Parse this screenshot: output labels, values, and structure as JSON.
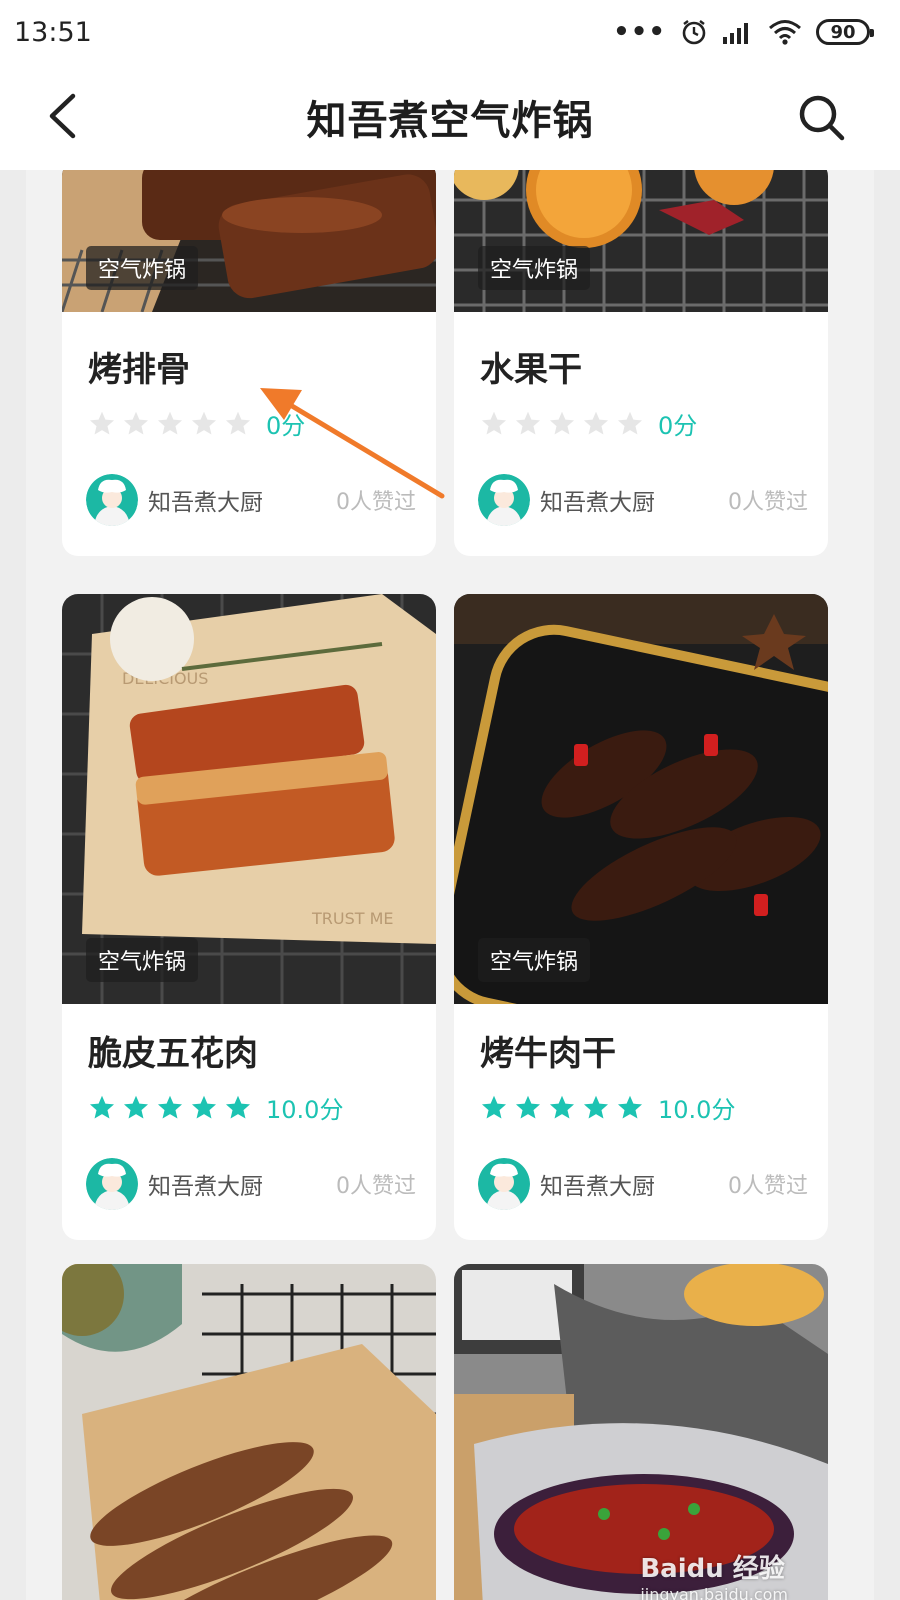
{
  "status_bar": {
    "time": "13:51",
    "battery": "90",
    "more_dots": "•••"
  },
  "header": {
    "title": "知吾煮空气炸锅"
  },
  "colors": {
    "accent": "#1cc3b2",
    "star_empty": "#e6e6e6",
    "tag_bg": "#2a2a2a"
  },
  "recipes": [
    {
      "title": "烤排骨",
      "tag": "空气炸锅",
      "score": "0分",
      "rating": 0,
      "author": "知吾煮大厨",
      "likes": "0人赞过"
    },
    {
      "title": "水果干",
      "tag": "空气炸锅",
      "score": "0分",
      "rating": 0,
      "author": "知吾煮大厨",
      "likes": "0人赞过"
    },
    {
      "title": "脆皮五花肉",
      "tag": "空气炸锅",
      "score": "10.0分",
      "rating": 5,
      "author": "知吾煮大厨",
      "likes": "0人赞过"
    },
    {
      "title": "烤牛肉干",
      "tag": "空气炸锅",
      "score": "10.0分",
      "rating": 5,
      "author": "知吾煮大厨",
      "likes": "0人赞过"
    }
  ],
  "watermark": {
    "brand": "Baidu 经验",
    "url": "jingyan.baidu.com"
  }
}
